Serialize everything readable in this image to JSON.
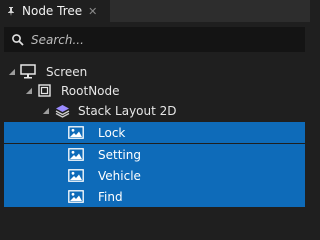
{
  "panel": {
    "tab_title": "Node Tree",
    "tab_pin_icon": "pin-icon",
    "tab_close_icon": "close-icon"
  },
  "search": {
    "placeholder": "Search...",
    "icon": "search-icon"
  },
  "tree": {
    "nodes": [
      {
        "label": "Screen",
        "icon": "monitor-icon",
        "expanded": true,
        "selected": false
      },
      {
        "label": "RootNode",
        "icon": "node-square-icon",
        "expanded": true,
        "selected": false
      },
      {
        "label": "Stack Layout 2D",
        "icon": "layers-icon",
        "expanded": true,
        "selected": false
      },
      {
        "label": "Lock",
        "icon": "image-icon",
        "selected": true
      },
      {
        "label": "Setting",
        "icon": "image-icon",
        "selected": true
      },
      {
        "label": "Vehicle",
        "icon": "image-icon",
        "selected": true
      },
      {
        "label": "Find",
        "icon": "image-icon",
        "selected": true
      }
    ]
  },
  "colors": {
    "selection": "#0e6bb9",
    "background": "#1f1f1f"
  }
}
